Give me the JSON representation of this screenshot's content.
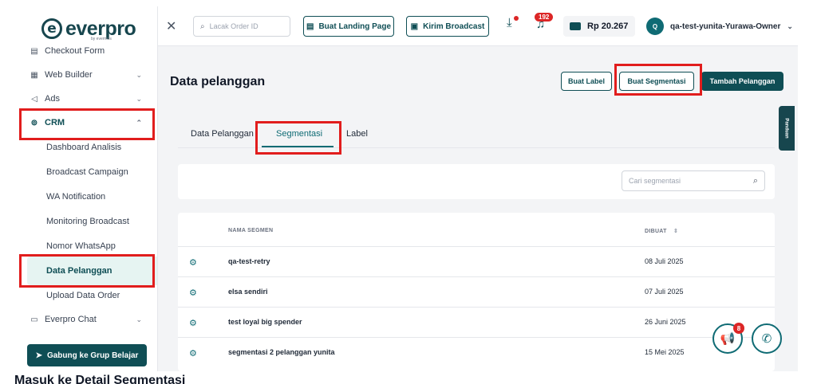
{
  "brand": {
    "name": "everpro",
    "mark": "e",
    "sub": "by evermos"
  },
  "sidebar": {
    "items": [
      {
        "label": "Checkout Form",
        "icon": "form-icon"
      },
      {
        "label": "Web Builder",
        "icon": "layout-icon"
      },
      {
        "label": "Ads",
        "icon": "megaphone-icon"
      },
      {
        "label": "CRM",
        "icon": "crm-icon"
      }
    ],
    "crm_sub": [
      "Dashboard Analisis",
      "Broadcast Campaign",
      "WA Notification",
      "Monitoring Broadcast",
      "Nomor WhatsApp",
      "Data Pelanggan",
      "Upload Data Order"
    ],
    "chat_label": "Everpro Chat",
    "join_label": "Gabung ke Grup Belajar"
  },
  "topbar": {
    "search_placeholder": "Lacak Order ID",
    "landing_label": "Buat Landing Page",
    "broadcast_label": "Kirim Broadcast",
    "notif_count": "192",
    "balance": "Rp 20.267",
    "user_initial": "Q",
    "user_name": "qa-test-yunita-Yurawa-Owner"
  },
  "page": {
    "title": "Data pelanggan",
    "buat_label": "Buat Label",
    "buat_segmentasi": "Buat Segmentasi",
    "tambah_pelanggan": "Tambah Pelanggan",
    "tabs": [
      "Data Pelanggan",
      "Segmentasi",
      "Label"
    ],
    "active_tab": "Segmentasi",
    "seg_search_placeholder": "Cari segmentasi"
  },
  "table": {
    "col_name": "NAMA SEGMEN",
    "col_date": "DIBUAT",
    "rows": [
      {
        "name": "qa-test-retry",
        "date": "08 Juli 2025"
      },
      {
        "name": "elsa sendiri",
        "date": "07 Juli 2025"
      },
      {
        "name": "test loyal big spender",
        "date": "26 Juni 2025"
      },
      {
        "name": "segmentasi 2 pelanggan yunita",
        "date": "15 Mei 2025"
      }
    ]
  },
  "side_tab": "Panduan",
  "float_badge": "8",
  "caption": "Masuk ke Detail Segmentasi",
  "colors": {
    "primary": "#0f4e55",
    "highlight": "#e11d1d",
    "badge": "#dc2626"
  }
}
